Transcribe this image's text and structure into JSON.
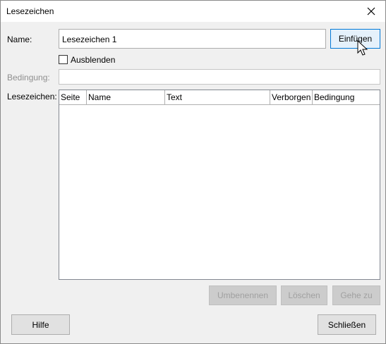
{
  "window": {
    "title": "Lesezeichen"
  },
  "form": {
    "name_label": "Name:",
    "name_value": "Lesezeichen 1",
    "hide_label": "Ausblenden",
    "hide_checked": false,
    "condition_label": "Bedingung:",
    "condition_value": "",
    "bookmarks_label": "Lesezeichen:"
  },
  "buttons": {
    "insert": "Einfügen",
    "rename": "Umbenennen",
    "delete": "Löschen",
    "goto": "Gehe zu",
    "help": "Hilfe",
    "close": "Schließen"
  },
  "table": {
    "columns": [
      "Seite",
      "Name",
      "Text",
      "Verborgen",
      "Bedingung"
    ],
    "rows": []
  },
  "icons": {
    "close": "close-icon",
    "cursor": "mouse-pointer-icon"
  }
}
